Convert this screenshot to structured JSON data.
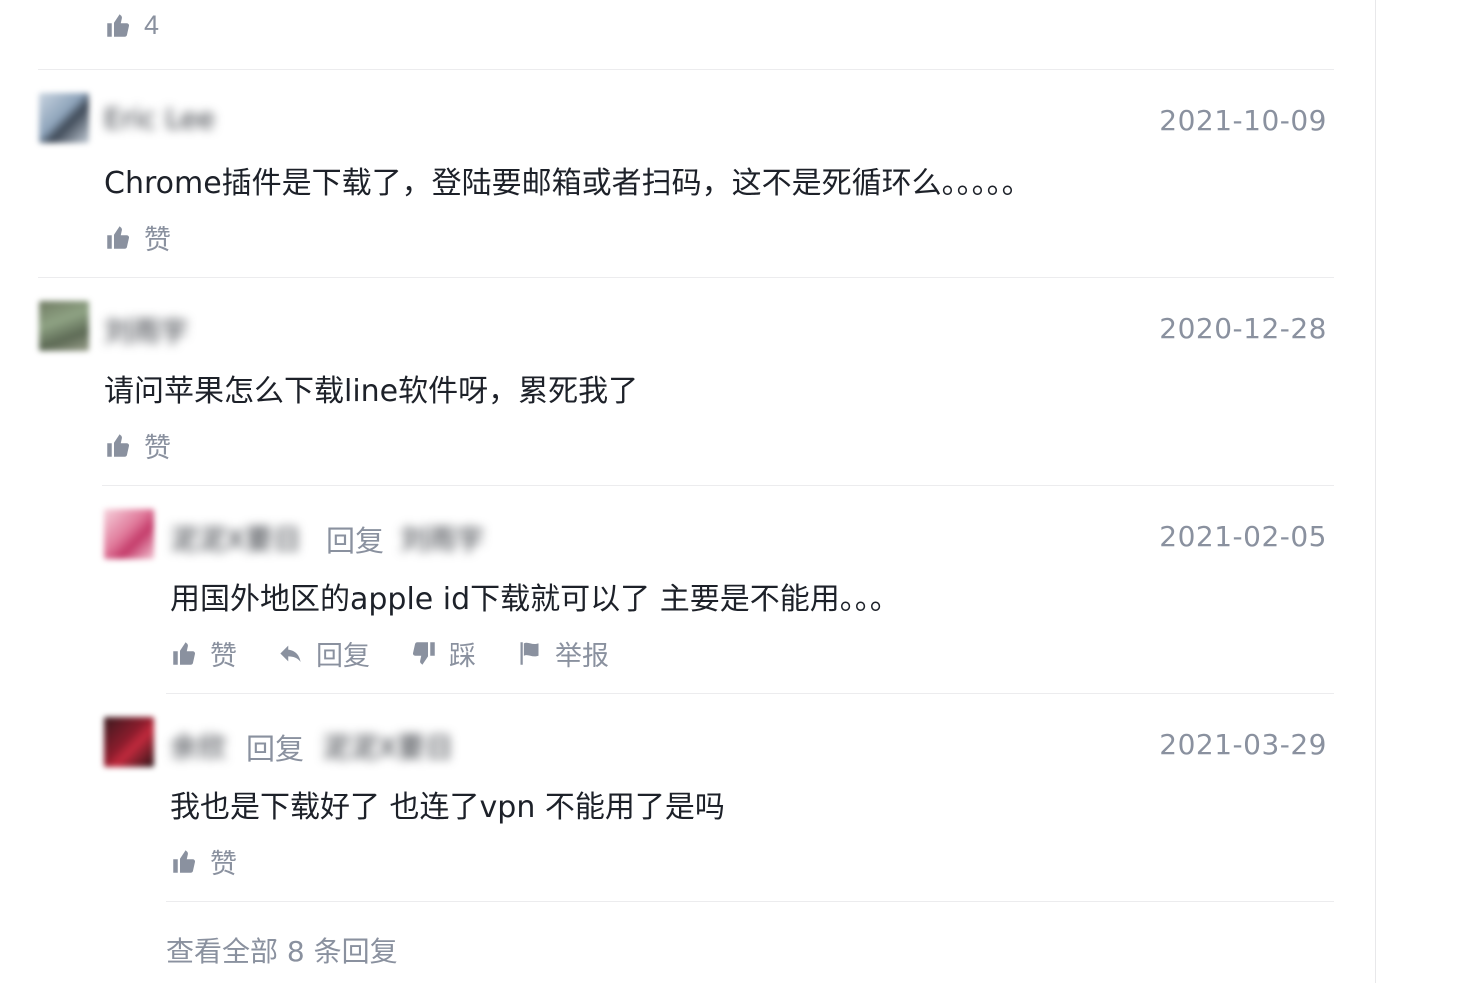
{
  "top_like": {
    "count": "4"
  },
  "comments": [
    {
      "author": "Eric Lee",
      "date": "2021-10-09",
      "text": "Chrome插件是下载了，登陆要邮箱或者扫码，这不是死循环么。。。。。",
      "like_label": "赞"
    },
    {
      "author": "刘雨宇",
      "date": "2020-12-28",
      "text": "请问苹果怎么下载line软件呀，累死我了",
      "like_label": "赞"
    }
  ],
  "replies": [
    {
      "author": "泥泥X要日",
      "reply_word": "回复",
      "reply_to": "刘雨宇",
      "date": "2021-02-05",
      "text": "用国外地区的apple id下载就可以了 主要是不能用。。。",
      "actions": {
        "like": "赞",
        "reply": "回复",
        "dislike": "踩",
        "report": "举报"
      }
    },
    {
      "author": "余欣",
      "reply_word": "回复",
      "reply_to": "泥泥X要日",
      "date": "2021-03-29",
      "text": "我也是下载好了 也连了vpn 不能用了是吗",
      "like_label": "赞"
    }
  ],
  "view_all": "查看全部 8 条回复",
  "colors": {
    "meta": "#8a919f",
    "text": "#1d2129",
    "divider": "#ececee"
  },
  "icons": [
    "thumbs-up-icon",
    "reply-arrow-icon",
    "thumbs-down-icon",
    "flag-icon"
  ]
}
